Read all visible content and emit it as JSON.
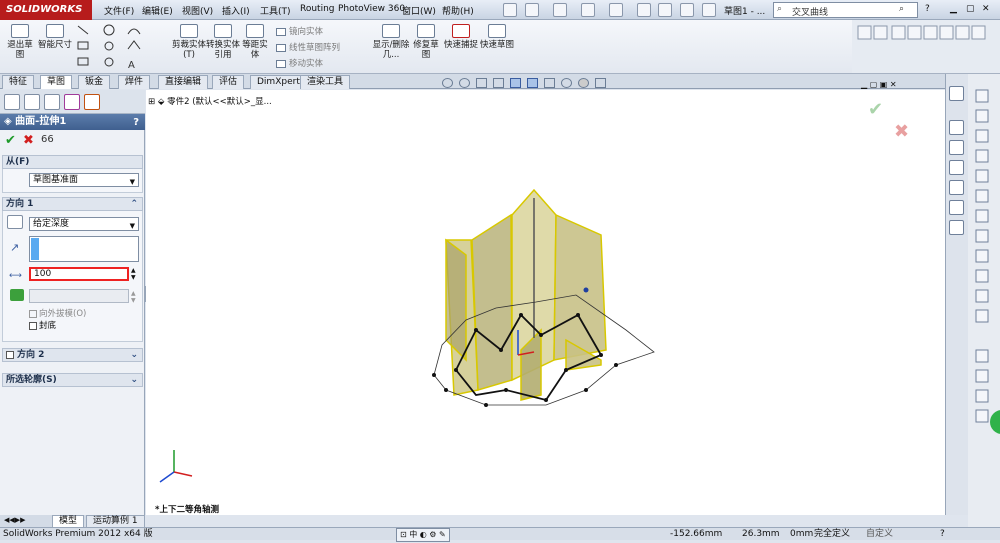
{
  "app": {
    "logo": "SOLIDWORKS",
    "doc_title": "草图1 - ..."
  },
  "menu": [
    "文件(F)",
    "编辑(E)",
    "视图(V)",
    "插入(I)",
    "工具(T)",
    "Routing",
    "PhotoView 360",
    "窗口(W)",
    "帮助(H)"
  ],
  "search": {
    "value": "交叉曲线",
    "button": "?"
  },
  "ribbon": {
    "exit_sketch": "退出草图",
    "smart_dimension": "智能尺寸",
    "trim": "剪裁实体(T)",
    "convert": "转换实体引用",
    "offset": "等距实体",
    "mirror": "镜向实体",
    "linear_pattern": "线性草图阵列",
    "move": "移动实体",
    "display_delete": "显示/删除几...",
    "repair": "修复草图",
    "quick_snaps": "快速捕捉",
    "rapid_sketch": "快速草图"
  },
  "tabs": [
    "特征",
    "草图",
    "钣金",
    "焊件",
    "直接编辑",
    "评估",
    "DimXpert",
    "渲染工具"
  ],
  "feature_manager": {
    "title": "曲面-拉伸1",
    "help": "?",
    "from": {
      "label": "从(F)",
      "value": "草图基准面"
    },
    "direction1": {
      "label": "方向 1",
      "end_condition": "给定深度",
      "depth": "100",
      "draft_outward": "向外拔模(O)",
      "cap_end": "封底"
    },
    "direction2": {
      "label": "方向 2"
    },
    "selected_contours": {
      "label": "所选轮廓(S)"
    }
  },
  "tree": {
    "root": "零件2 (默认<<默认>_显..."
  },
  "view_orientation": "*上下二等角轴测",
  "model_tabs": [
    "模型",
    "运动算例 1"
  ],
  "status": {
    "app_name": "SolidWorks Premium 2012 x64 版",
    "x": "-152.66mm",
    "y": "26.3mm",
    "z": "0mm",
    "state": "完全定义",
    "custom": "自定义"
  },
  "colors": {
    "accent": "#3f5f8f",
    "logo": "#b71c1c",
    "ok": "#1e9a2a",
    "cancel": "#d21f1f",
    "highlight": "#e22",
    "surface": "#c8c27a"
  }
}
